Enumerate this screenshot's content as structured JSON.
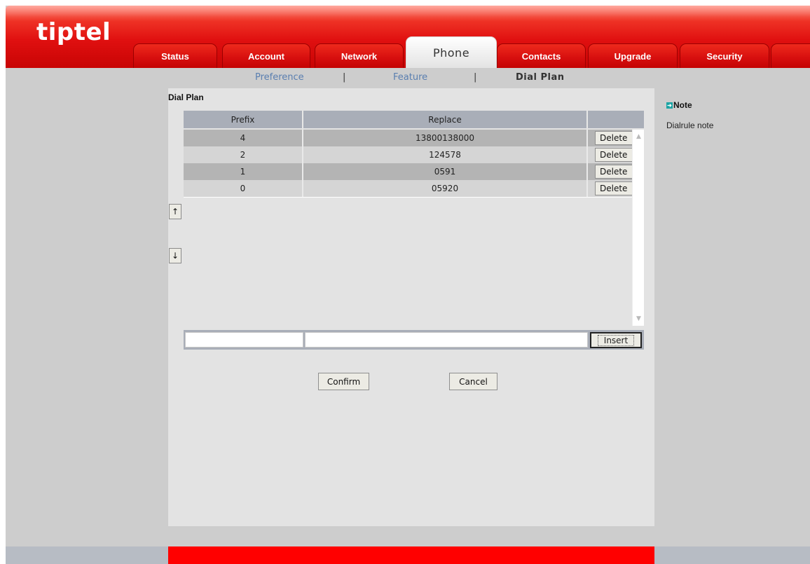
{
  "brand": {
    "logo_text": "tiptel",
    "header_color": "#e01010",
    "accent_color": "#ff0000"
  },
  "nav": {
    "tabs": [
      {
        "label": "Status",
        "active": false
      },
      {
        "label": "Account",
        "active": false
      },
      {
        "label": "Network",
        "active": false
      },
      {
        "label": "Phone",
        "active": true
      },
      {
        "label": "Contacts",
        "active": false
      },
      {
        "label": "Upgrade",
        "active": false
      },
      {
        "label": "Security",
        "active": false
      },
      {
        "label": "",
        "active": false
      }
    ]
  },
  "subnav": {
    "items": [
      {
        "label": "Preference",
        "current": false
      },
      {
        "label": "Feature",
        "current": false
      },
      {
        "label": "Dial Plan",
        "current": true
      }
    ],
    "separator": "|"
  },
  "panel": {
    "title": "Dial Plan",
    "columns": {
      "prefix": "Prefix",
      "replace": "Replace",
      "action": ""
    },
    "rows": [
      {
        "prefix": "4",
        "replace": "13800138000",
        "action": "Delete"
      },
      {
        "prefix": "2",
        "replace": "124578",
        "action": "Delete"
      },
      {
        "prefix": "1",
        "replace": "0591",
        "action": "Delete"
      },
      {
        "prefix": "0",
        "replace": "05920",
        "action": "Delete"
      }
    ],
    "move_up_glyph": "↑",
    "move_down_glyph": "↓",
    "insert": {
      "prefix_value": "",
      "replace_value": "",
      "button_label": "Insert"
    },
    "confirm_label": "Confirm",
    "cancel_label": "Cancel"
  },
  "note": {
    "title": "Note",
    "text": "Dialrule note",
    "icon": "arrow-right-icon"
  }
}
